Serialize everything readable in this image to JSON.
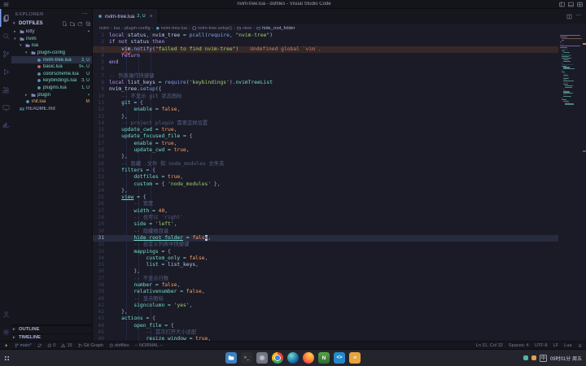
{
  "window": {
    "title": "nvim-tree.lua - dotfiles - Visual Studio Code"
  },
  "colors": {
    "accent": "#7aa2f7",
    "untracked": "#73daca",
    "modified": "#e0af68",
    "error_line": "#c17f6c"
  },
  "activity_bar": {
    "items": [
      {
        "id": "explorer",
        "icon": "files-icon",
        "active": true
      },
      {
        "id": "search",
        "icon": "search-icon",
        "active": false
      },
      {
        "id": "source-control",
        "icon": "source-control-icon",
        "active": false
      },
      {
        "id": "run-debug",
        "icon": "run-debug-icon",
        "active": false
      },
      {
        "id": "extensions",
        "icon": "extensions-icon",
        "active": false
      },
      {
        "id": "remote-explorer",
        "icon": "remote-explorer-icon",
        "active": false
      },
      {
        "id": "docker",
        "icon": "docker-icon",
        "active": false
      }
    ],
    "bottom": [
      {
        "id": "account",
        "icon": "account-icon"
      },
      {
        "id": "settings",
        "icon": "gear-icon"
      }
    ]
  },
  "sidebar": {
    "header": "EXPLORER",
    "header_menu": "⋯",
    "section": {
      "label": "DOTFILES",
      "actions": [
        "new-file-icon",
        "new-folder-icon",
        "refresh-icon",
        "collapse-all-icon"
      ]
    },
    "tree": [
      {
        "label": "kitty",
        "depth": 0,
        "kind": "folder",
        "expanded": false,
        "color": "default",
        "badge": "•",
        "badge_color": "green"
      },
      {
        "label": "nvim",
        "depth": 0,
        "kind": "folder",
        "expanded": true,
        "color": "green"
      },
      {
        "label": "lua",
        "depth": 1,
        "kind": "folder",
        "expanded": true,
        "color": "green"
      },
      {
        "label": "plugin-config",
        "depth": 2,
        "kind": "folder",
        "expanded": true,
        "color": "green"
      },
      {
        "label": "nvim-tree.lua",
        "depth": 3,
        "kind": "lua",
        "color": "green",
        "badge": "2, U",
        "selected": true
      },
      {
        "label": "basic.lua",
        "depth": 3,
        "kind": "lua-red",
        "color": "green",
        "badge": "9+, U"
      },
      {
        "label": "colorscheme.lua",
        "depth": 3,
        "kind": "lua",
        "color": "green",
        "badge": "U"
      },
      {
        "label": "keybindings.lua",
        "depth": 3,
        "kind": "lua",
        "color": "green",
        "badge": "3, U"
      },
      {
        "label": "plugins.lua",
        "depth": 3,
        "kind": "lua",
        "color": "green",
        "badge": "1, U"
      },
      {
        "label": "plugin",
        "depth": 2,
        "kind": "folder",
        "expanded": false,
        "color": "green",
        "badge": "•",
        "badge_color": "green"
      },
      {
        "label": "init.lua",
        "depth": 1,
        "kind": "lua",
        "color": "orange",
        "badge": "M"
      },
      {
        "label": "README.md",
        "depth": 0,
        "kind": "markdown",
        "color": "default"
      }
    ],
    "bottom_sections": [
      {
        "label": "OUTLINE"
      },
      {
        "label": "TIMELINE"
      }
    ]
  },
  "editor": {
    "tab": {
      "label": "nvim-tree.lua",
      "badge": "2, U",
      "close": "×"
    },
    "tab_actions": [
      "split-editor-icon",
      "more-actions-icon"
    ],
    "breadcrumbs": [
      {
        "label": "nvim"
      },
      {
        "label": "lua"
      },
      {
        "label": "plugin-config"
      },
      {
        "label": "nvim-tree.lua",
        "icon": "lua-file-icon"
      },
      {
        "label": "nvim-tree.setup()",
        "icon": "symbol-method-icon"
      },
      {
        "label": "view",
        "icon": "symbol-field-icon"
      },
      {
        "label": "hide_root_folder",
        "icon": "symbol-field-icon"
      }
    ],
    "code": {
      "lines": [
        {
          "n": 1,
          "t": [
            [
              "kw",
              "local "
            ],
            [
              "var",
              "status"
            ],
            [
              "punc",
              ", "
            ],
            [
              "var",
              "nvim_tree "
            ],
            [
              "op",
              "= "
            ],
            [
              "fn",
              "pcall"
            ],
            [
              "punc",
              "("
            ],
            [
              "fn",
              "require"
            ],
            [
              "punc",
              ", "
            ],
            [
              "str",
              "\"nvim-tree\""
            ],
            [
              "punc",
              ")"
            ]
          ]
        },
        {
          "n": 2,
          "t": [
            [
              "kw",
              "if "
            ],
            [
              "kw",
              "not "
            ],
            [
              "var",
              "status "
            ],
            [
              "kw",
              "then"
            ]
          ]
        },
        {
          "n": 3,
          "error": true,
          "t": [
            [
              "plain",
              "    "
            ],
            [
              "errvar",
              "vim"
            ],
            [
              "punc",
              "."
            ],
            [
              "fn",
              "notify"
            ],
            [
              "punc",
              "("
            ],
            [
              "str",
              "\"failed to find nvim-tree\""
            ],
            [
              "punc",
              ")"
            ],
            [
              "diag",
              "Undefined global `vim`."
            ]
          ]
        },
        {
          "n": 4,
          "t": [
            [
              "kw",
              "    return"
            ]
          ]
        },
        {
          "n": 5,
          "t": [
            [
              "kw",
              "end"
            ]
          ]
        },
        {
          "n": 6,
          "t": []
        },
        {
          "n": 7,
          "t": [
            [
              "cmt",
              "-- 列表操作快捷键"
            ]
          ]
        },
        {
          "n": 8,
          "t": [
            [
              "kw",
              "local "
            ],
            [
              "var",
              "list_keys "
            ],
            [
              "op",
              "= "
            ],
            [
              "fn",
              "require"
            ],
            [
              "punc",
              "("
            ],
            [
              "str",
              "'keybindings'"
            ],
            [
              "punc",
              ")."
            ],
            [
              "prop",
              "nvimTreeList"
            ]
          ]
        },
        {
          "n": 9,
          "t": [
            [
              "var",
              "nvim_tree"
            ],
            [
              "punc",
              "."
            ],
            [
              "fn",
              "setup"
            ],
            [
              "punc",
              "({"
            ]
          ]
        },
        {
          "n": 10,
          "t": [
            [
              "cmt",
              "    -- 不显示 git 状态图标"
            ]
          ]
        },
        {
          "n": 11,
          "t": [
            [
              "prop",
              "    git "
            ],
            [
              "op",
              "= "
            ],
            [
              "punc",
              "{"
            ]
          ]
        },
        {
          "n": 12,
          "t": [
            [
              "prop",
              "        enable "
            ],
            [
              "op",
              "= "
            ],
            [
              "bool",
              "false"
            ],
            [
              "punc",
              ","
            ]
          ]
        },
        {
          "n": 13,
          "t": [
            [
              "punc",
              "    },"
            ]
          ]
        },
        {
          "n": 14,
          "t": [
            [
              "cmt",
              "    -- project plugin 需要这样设置"
            ]
          ]
        },
        {
          "n": 15,
          "t": [
            [
              "prop",
              "    update_cwd "
            ],
            [
              "op",
              "= "
            ],
            [
              "bool",
              "true"
            ],
            [
              "punc",
              ","
            ]
          ]
        },
        {
          "n": 16,
          "t": [
            [
              "prop",
              "    update_focused_file "
            ],
            [
              "op",
              "= "
            ],
            [
              "punc",
              "{"
            ]
          ]
        },
        {
          "n": 17,
          "t": [
            [
              "prop",
              "        enable "
            ],
            [
              "op",
              "= "
            ],
            [
              "bool",
              "true"
            ],
            [
              "punc",
              ","
            ]
          ]
        },
        {
          "n": 18,
          "t": [
            [
              "prop",
              "        update_cwd "
            ],
            [
              "op",
              "= "
            ],
            [
              "bool",
              "true"
            ],
            [
              "punc",
              ","
            ]
          ]
        },
        {
          "n": 19,
          "t": [
            [
              "punc",
              "    },"
            ]
          ]
        },
        {
          "n": 20,
          "t": [
            [
              "cmt",
              "    -- 隐藏 .文件 和 node_modules 文件夹"
            ]
          ]
        },
        {
          "n": 21,
          "t": [
            [
              "prop",
              "    filters "
            ],
            [
              "op",
              "= "
            ],
            [
              "punc",
              "{"
            ]
          ]
        },
        {
          "n": 22,
          "t": [
            [
              "prop",
              "        dotfiles "
            ],
            [
              "op",
              "= "
            ],
            [
              "bool",
              "true"
            ],
            [
              "punc",
              ","
            ]
          ]
        },
        {
          "n": 23,
          "t": [
            [
              "prop",
              "        custom "
            ],
            [
              "op",
              "= "
            ],
            [
              "punc",
              "{ "
            ],
            [
              "str",
              "'node_modules'"
            ],
            [
              "punc",
              " },"
            ]
          ]
        },
        {
          "n": 24,
          "t": [
            [
              "punc",
              "    },"
            ]
          ]
        },
        {
          "n": 25,
          "t": [
            [
              "plain",
              "    "
            ],
            [
              "propu",
              "view"
            ],
            [
              "op",
              " = "
            ],
            [
              "punc",
              "{"
            ]
          ]
        },
        {
          "n": 26,
          "t": [
            [
              "cmt",
              "        -- 宽度"
            ]
          ]
        },
        {
          "n": 27,
          "t": [
            [
              "prop",
              "        width "
            ],
            [
              "op",
              "= "
            ],
            [
              "num",
              "40"
            ],
            [
              "punc",
              ","
            ]
          ]
        },
        {
          "n": 28,
          "t": [
            [
              "cmt",
              "        -- 也可以 'right'"
            ]
          ]
        },
        {
          "n": 29,
          "t": [
            [
              "prop",
              "        side "
            ],
            [
              "op",
              "= "
            ],
            [
              "str",
              "'left'"
            ],
            [
              "punc",
              ","
            ]
          ]
        },
        {
          "n": 30,
          "t": [
            [
              "cmt",
              "        -- 隐藏根目录"
            ]
          ]
        },
        {
          "n": 31,
          "current": true,
          "t": [
            [
              "plain",
              "        "
            ],
            [
              "propu",
              "hide_root_folder"
            ],
            [
              "op",
              " = "
            ],
            [
              "bool",
              "fals"
            ],
            [
              "cursor",
              "e"
            ],
            [
              "punc",
              ","
            ]
          ]
        },
        {
          "n": 32,
          "t": [
            [
              "cmt",
              "        -- 自定义列表中快捷键"
            ]
          ]
        },
        {
          "n": 33,
          "t": [
            [
              "prop",
              "        mappings "
            ],
            [
              "op",
              "= "
            ],
            [
              "punc",
              "{"
            ]
          ]
        },
        {
          "n": 34,
          "t": [
            [
              "prop",
              "            custom_only "
            ],
            [
              "op",
              "= "
            ],
            [
              "bool",
              "false"
            ],
            [
              "punc",
              ","
            ]
          ]
        },
        {
          "n": 35,
          "t": [
            [
              "prop",
              "            list "
            ],
            [
              "op",
              "= "
            ],
            [
              "var",
              "list_keys"
            ],
            [
              "punc",
              ","
            ]
          ]
        },
        {
          "n": 36,
          "t": [
            [
              "punc",
              "        },"
            ]
          ]
        },
        {
          "n": 37,
          "t": [
            [
              "cmt",
              "        -- 不显示行数"
            ]
          ]
        },
        {
          "n": 38,
          "t": [
            [
              "prop",
              "        number "
            ],
            [
              "op",
              "= "
            ],
            [
              "bool",
              "false"
            ],
            [
              "punc",
              ","
            ]
          ]
        },
        {
          "n": 39,
          "t": [
            [
              "prop",
              "        relativenumber "
            ],
            [
              "op",
              "= "
            ],
            [
              "bool",
              "false"
            ],
            [
              "punc",
              ","
            ]
          ]
        },
        {
          "n": 40,
          "t": [
            [
              "cmt",
              "        -- 显示图标"
            ]
          ]
        },
        {
          "n": 41,
          "t": [
            [
              "prop",
              "        signcolumn "
            ],
            [
              "op",
              "= "
            ],
            [
              "str",
              "'yes'"
            ],
            [
              "punc",
              ","
            ]
          ]
        },
        {
          "n": 42,
          "t": [
            [
              "punc",
              "    },"
            ]
          ]
        },
        {
          "n": 43,
          "t": [
            [
              "prop",
              "    actions "
            ],
            [
              "op",
              "= "
            ],
            [
              "punc",
              "{"
            ]
          ]
        },
        {
          "n": 44,
          "t": [
            [
              "prop",
              "        open_file "
            ],
            [
              "op",
              "= "
            ],
            [
              "punc",
              "{"
            ]
          ]
        },
        {
          "n": 45,
          "t": [
            [
              "cmt",
              "            -- 首次打开大小适配"
            ]
          ]
        },
        {
          "n": 46,
          "t": [
            [
              "prop",
              "            resize_window "
            ],
            [
              "op",
              "= "
            ],
            [
              "bool",
              "true"
            ],
            [
              "punc",
              ","
            ]
          ]
        }
      ]
    }
  },
  "status_bar": {
    "left": [
      {
        "id": "remote",
        "icon": "zap-icon",
        "label": ""
      },
      {
        "id": "branch",
        "icon": "git-branch-icon",
        "label": "main*"
      },
      {
        "id": "sync",
        "icon": "sync-icon",
        "label": ""
      },
      {
        "id": "errors",
        "icon": "error-icon",
        "label": "0"
      },
      {
        "id": "warnings",
        "icon": "warning-icon",
        "label": "15"
      },
      {
        "id": "git-graph",
        "icon": "git-graph-icon",
        "label": "Git Graph"
      },
      {
        "id": "project",
        "icon": "history-icon",
        "label": "dotfiles"
      },
      {
        "id": "vim-mode",
        "label": "-- NORMAL --"
      }
    ],
    "right": [
      {
        "id": "cursor-position",
        "label": "Ln 31, Col 32"
      },
      {
        "id": "indentation",
        "label": "Spaces: 4"
      },
      {
        "id": "encoding",
        "label": "UTF-8"
      },
      {
        "id": "eol",
        "label": "LF"
      },
      {
        "id": "language",
        "label": "Lua"
      },
      {
        "id": "notifications",
        "icon": "bell-icon",
        "label": ""
      }
    ]
  },
  "taskbar": {
    "apps": [
      "file-manager",
      "terminal",
      "settings",
      "chrome",
      "edge",
      "firefox",
      "neovim",
      "vscode",
      "notes"
    ],
    "tray": {
      "input_method": "中",
      "clock": "09时01分",
      "weekday": "周五"
    }
  }
}
